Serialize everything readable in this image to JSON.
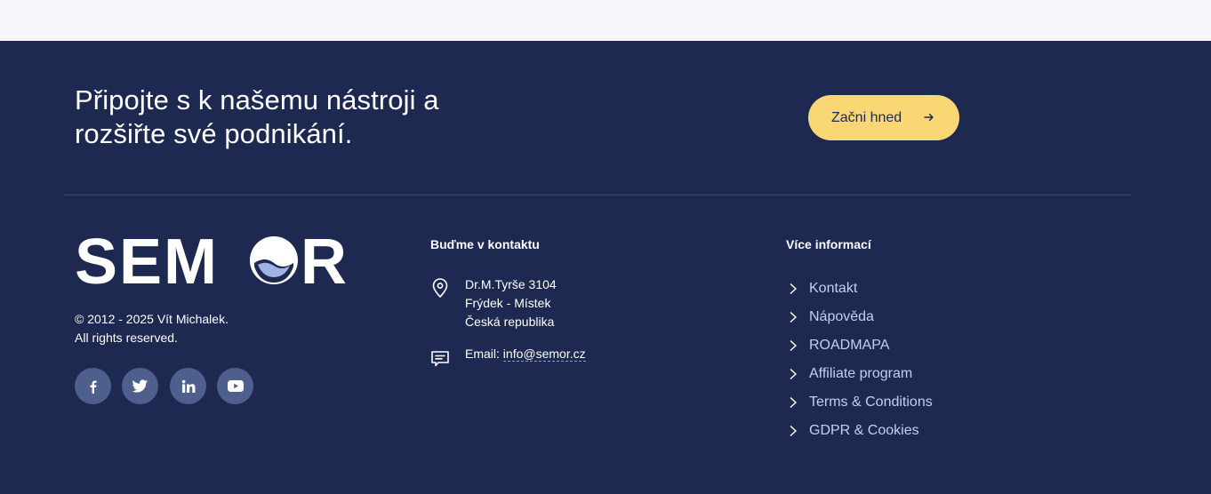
{
  "cta": {
    "heading_line1": "Připojte s k našemu nástroji a",
    "heading_line2": "rozšiřte své podnikání.",
    "button_label": "Začni hned"
  },
  "brand": {
    "logo_text": "SEMOR",
    "copyright_line1": "© 2012 - 2025 Vít Michalek.",
    "copyright_line2": "All rights reserved.",
    "social": [
      "facebook-icon",
      "twitter-icon",
      "linkedin-icon",
      "youtube-icon"
    ]
  },
  "contact": {
    "heading": "Buďme v kontaktu",
    "address": [
      "Dr.M.Tyrše 3104",
      "Frýdek - Místek",
      "Česká republika"
    ],
    "email_label": "Email: ",
    "email": "info@semor.cz"
  },
  "info": {
    "heading": "Více informací",
    "links": [
      "Kontakt",
      "Nápověda",
      "ROADMAPA",
      "Affiliate program",
      "Terms & Conditions",
      "GDPR & Cookies"
    ]
  },
  "colors": {
    "footer_bg": "#1d2950",
    "accent": "#f9d775",
    "link": "#c3cff0",
    "social_bg": "#4e5f8e"
  }
}
